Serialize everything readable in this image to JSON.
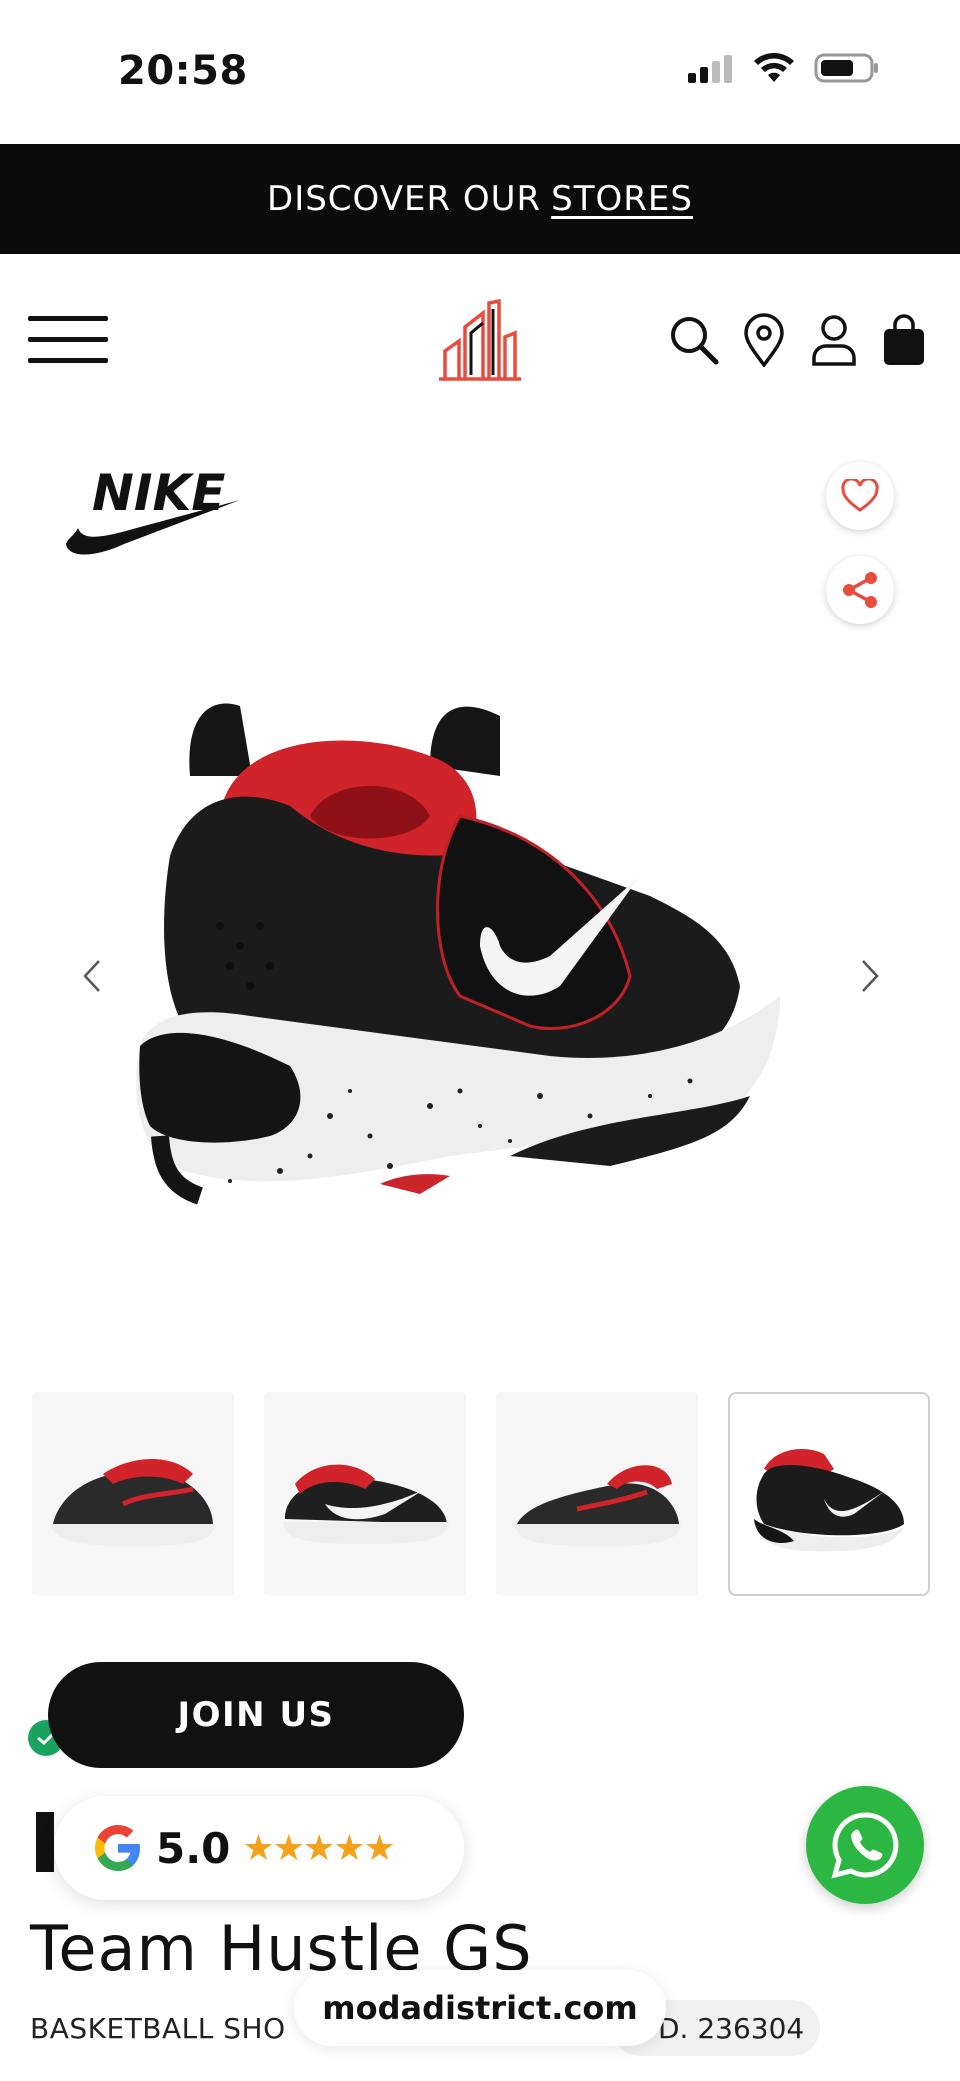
{
  "status_bar": {
    "time": "20:58"
  },
  "promo": {
    "text": "DISCOVER OUR ",
    "link": "STORES"
  },
  "header": {
    "icons": [
      "menu-icon",
      "search-icon",
      "location-pin-icon",
      "user-icon",
      "shopping-bag-icon"
    ]
  },
  "product": {
    "brand_logo": "NIKE",
    "title": "Team Hustle GS",
    "category": "BASKETBALL SHO",
    "id": "D. 236304"
  },
  "gallery": {
    "thumbnail_count": 4,
    "active_thumbnail": 4
  },
  "join": {
    "label": "JOIN US"
  },
  "rating": {
    "value": "5.0",
    "stars": "★★★★★"
  },
  "browser": {
    "url": "modadistrict.com"
  },
  "colors": {
    "accent": "#e84c3d",
    "dark": "#0b0b0b",
    "whatsapp": "#2bb741",
    "star": "#f4a21b"
  }
}
